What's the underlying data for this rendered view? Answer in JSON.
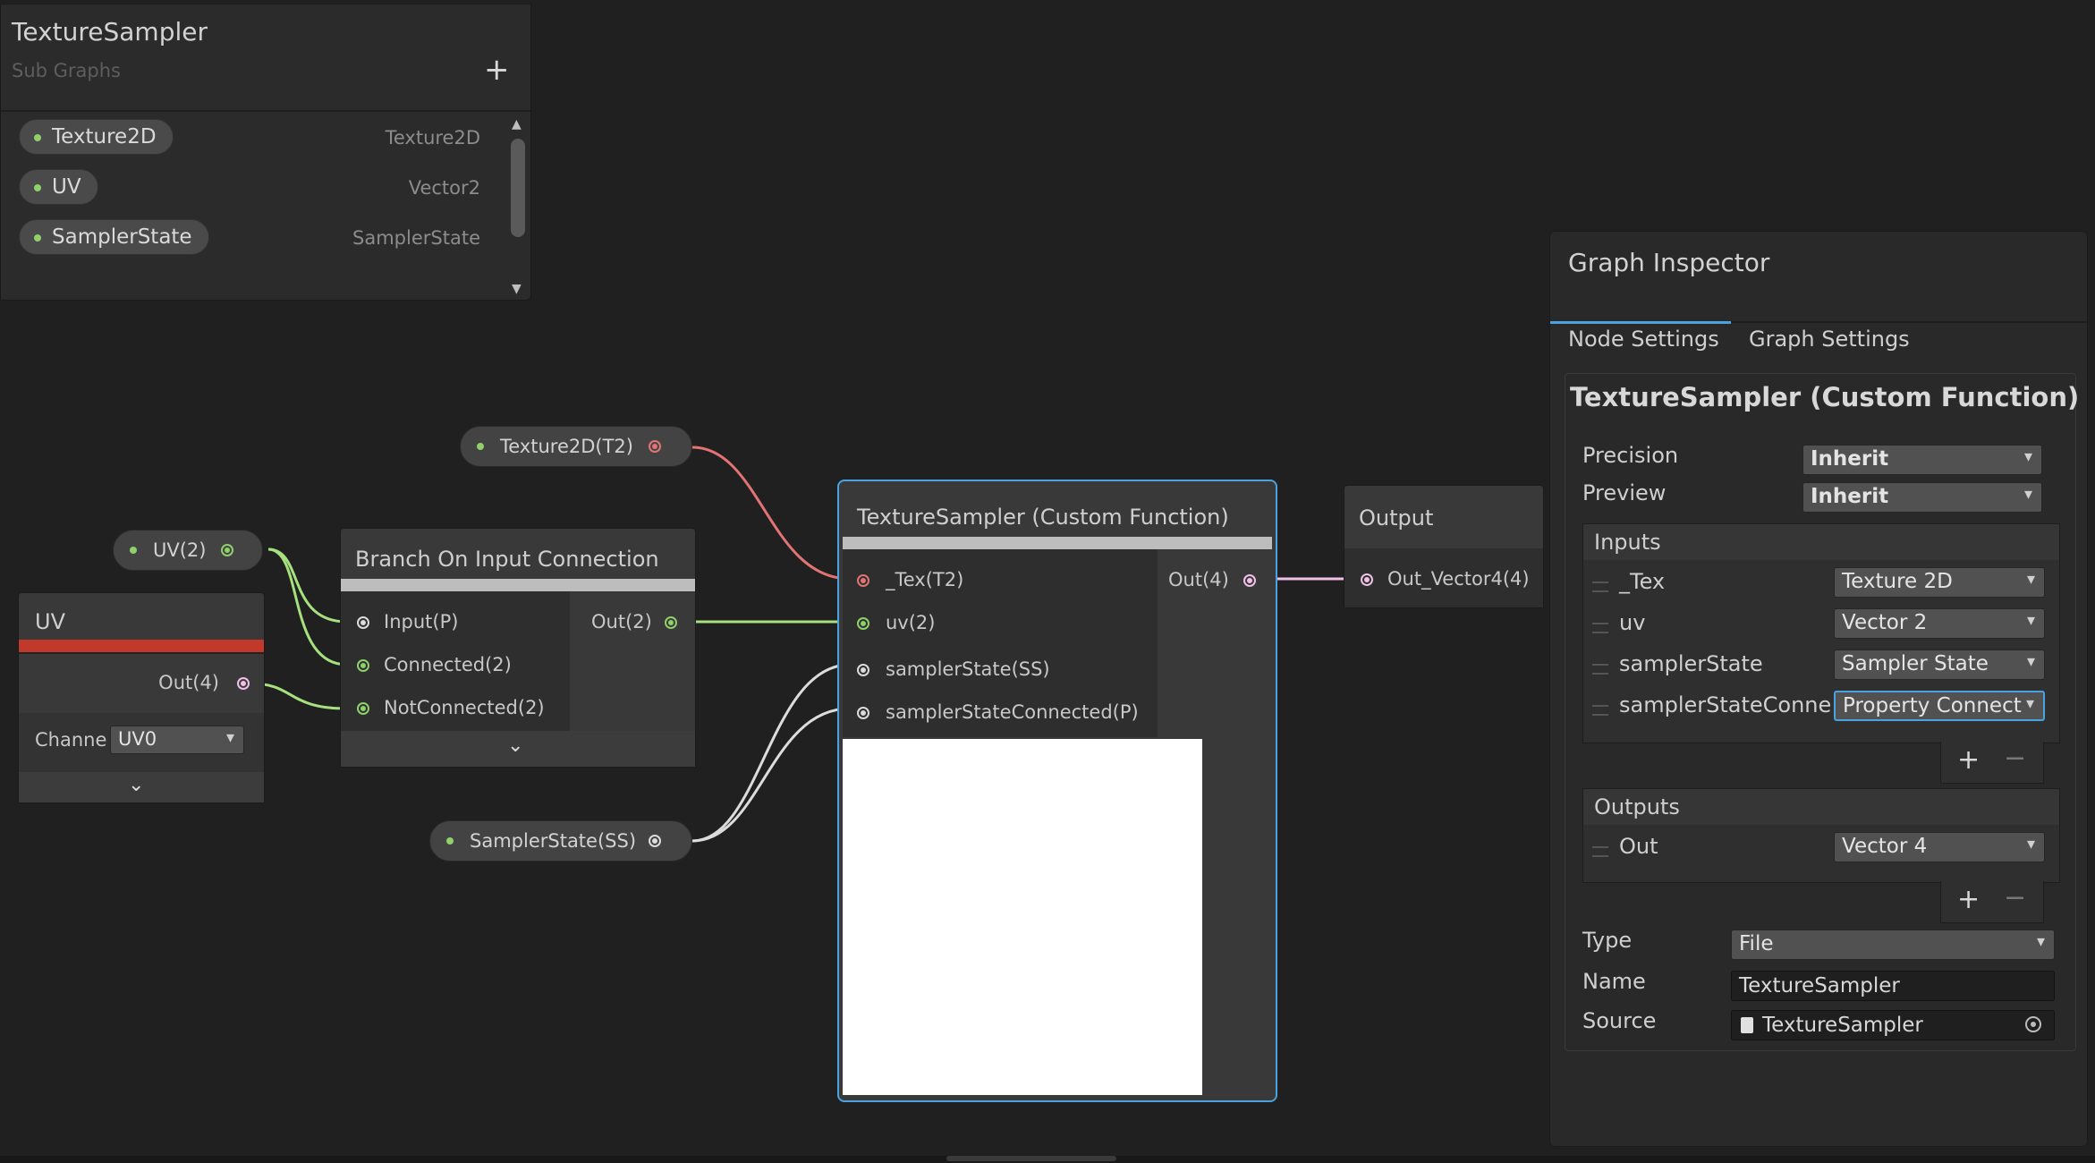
{
  "blackboard": {
    "title": "TextureSampler",
    "subtitle": "Sub Graphs",
    "add_icon": "plus-icon",
    "properties": [
      {
        "name": "Texture2D",
        "type": "Texture2D"
      },
      {
        "name": "UV",
        "type": "Vector2"
      },
      {
        "name": "SamplerState",
        "type": "SamplerState"
      }
    ]
  },
  "nodes": {
    "uv": {
      "title": "UV",
      "out_port": "Out(4)",
      "channel_label": "Channe",
      "channel_value": "UV0"
    },
    "branch": {
      "title": "Branch On Input Connection",
      "inputs": [
        "Input(P)",
        "Connected(2)",
        "NotConnected(2)"
      ],
      "output": "Out(2)"
    },
    "custom_function": {
      "title": "TextureSampler (Custom Function)",
      "inputs": [
        "_Tex(T2)",
        "uv(2)",
        "samplerState(SS)",
        "samplerStateConnected(P)"
      ],
      "output": "Out(4)"
    },
    "output": {
      "title": "Output",
      "input": "Out_Vector4(4)"
    }
  },
  "property_nodes": {
    "texture": "Texture2D(T2)",
    "uv": "UV(2)",
    "sampler": "SamplerState(SS)"
  },
  "inspector": {
    "title": "Graph Inspector",
    "tabs": [
      "Node Settings",
      "Graph Settings"
    ],
    "active_tab": "Node Settings",
    "node_header": "TextureSampler (Custom Function) Nod",
    "precision_label": "Precision",
    "precision_value": "Inherit",
    "preview_label": "Preview",
    "preview_value": "Inherit",
    "inputs_header": "Inputs",
    "inputs": [
      {
        "name": "_Tex",
        "type": "Texture 2D"
      },
      {
        "name": "uv",
        "type": "Vector 2"
      },
      {
        "name": "samplerState",
        "type": "Sampler State"
      },
      {
        "name": "samplerStateConnec",
        "type": "Property Connect"
      }
    ],
    "outputs_header": "Outputs",
    "outputs": [
      {
        "name": "Out",
        "type": "Vector 4"
      }
    ],
    "type_label": "Type",
    "type_value": "File",
    "name_label": "Name",
    "name_value": "TextureSampler",
    "source_label": "Source",
    "source_value": "TextureSampler"
  },
  "colors": {
    "vector2": "#8fd06a",
    "texture": "#e27474",
    "vector4": "#f0c0e8",
    "sampler": "#dcdcdc",
    "selection": "#4aa3df",
    "uv_bar": "#c0392b"
  }
}
